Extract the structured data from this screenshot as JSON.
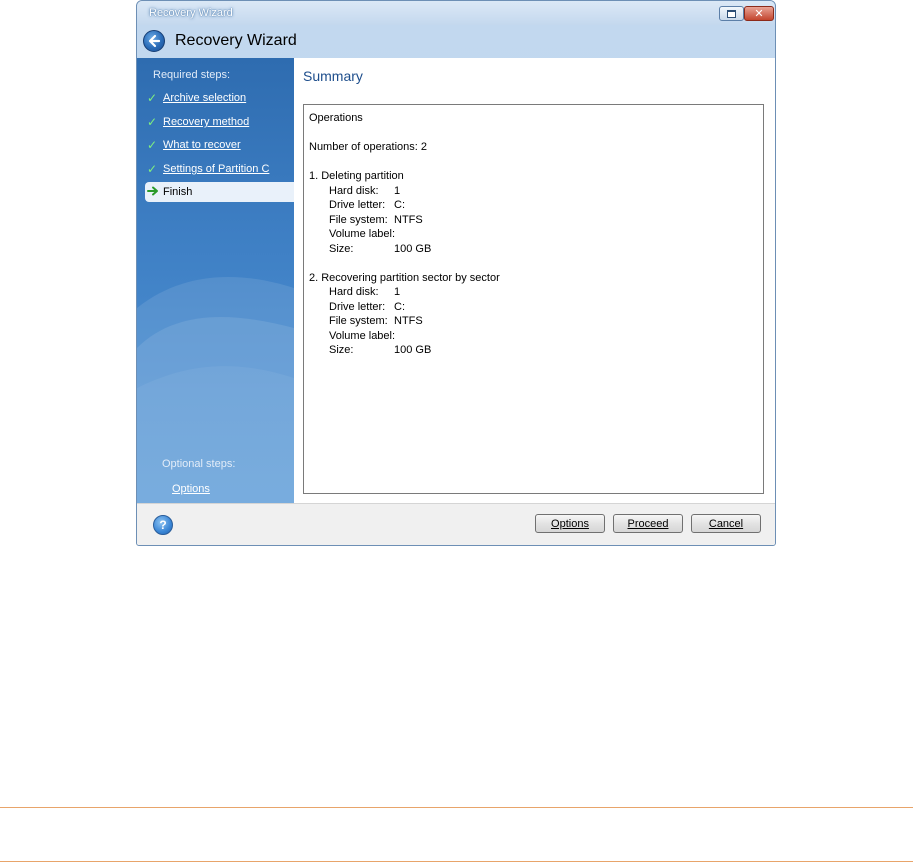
{
  "window": {
    "title": "Recovery Wizard",
    "header_title": "Recovery Wizard"
  },
  "sidebar": {
    "required_heading": "Required steps:",
    "steps": [
      {
        "label": "Archive selection",
        "done": true
      },
      {
        "label": "Recovery method",
        "done": true
      },
      {
        "label": "What to recover",
        "done": true
      },
      {
        "label": "Settings of Partition C",
        "done": true
      },
      {
        "label": "Finish",
        "current": true
      }
    ],
    "optional_heading": "Optional steps:",
    "optional_link": "Options"
  },
  "content": {
    "title": "Summary",
    "summary": {
      "heading": "Operations",
      "count": "Number of operations: 2",
      "operations": [
        {
          "title": "1. Deleting partition",
          "fields": [
            {
              "key": "Hard disk:",
              "value": "1"
            },
            {
              "key": "Drive letter:",
              "value": "C:"
            },
            {
              "key": "File system:",
              "value": "NTFS"
            },
            {
              "key": "Volume label:",
              "value": ""
            },
            {
              "key": "Size:",
              "value": "100 GB"
            }
          ]
        },
        {
          "title": "2. Recovering partition sector by sector",
          "fields": [
            {
              "key": "Hard disk:",
              "value": "1"
            },
            {
              "key": "Drive letter:",
              "value": "C:"
            },
            {
              "key": "File system:",
              "value": "NTFS"
            },
            {
              "key": "Volume label:",
              "value": ""
            },
            {
              "key": "Size:",
              "value": "100 GB"
            }
          ]
        }
      ]
    }
  },
  "footer": {
    "options_label": "Options",
    "proceed_label": "Proceed",
    "cancel_label": "Cancel"
  },
  "colors": {
    "sidebar_blue": "#3e7fc4",
    "title_blue": "#1e4e8c",
    "rule_orange": "#e8a46a"
  },
  "icons": [
    "back-arrow-icon",
    "checkmark-icon",
    "green-arrow-icon",
    "help-icon",
    "restore-icon",
    "close-icon"
  ]
}
